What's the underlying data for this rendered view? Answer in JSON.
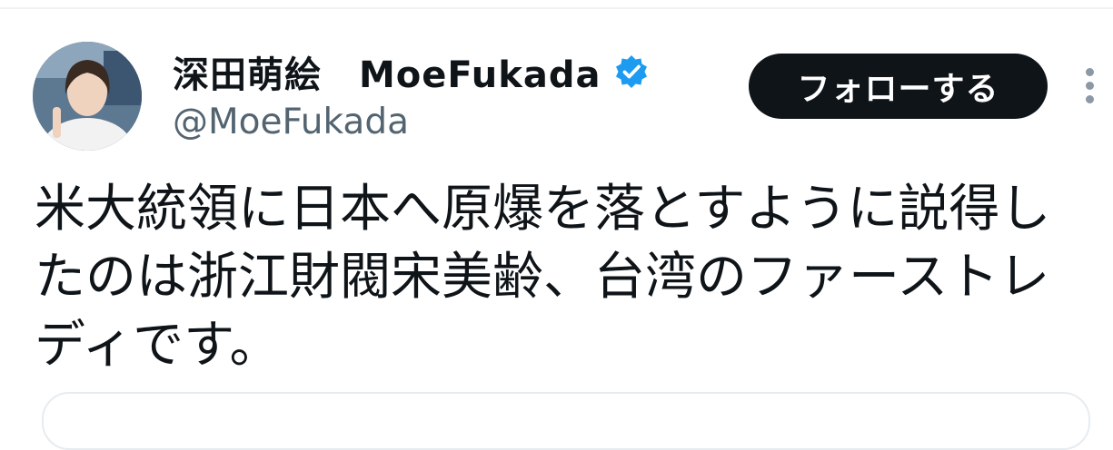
{
  "tweet": {
    "author": {
      "display_name": "深田萌絵　MoeFukada",
      "handle": "@MoeFukada",
      "verified_icon": "verified-badge-icon"
    },
    "follow_button_label": "フォローする",
    "more_icon": "more-vertical-icon",
    "text": "米大統領に日本へ原爆を落とすように説得したのは浙江財閥宋美齢、台湾のファーストレディです。"
  },
  "colors": {
    "primary_text": "#0f1419",
    "secondary_text": "#536471",
    "verified_blue": "#1d9bf0",
    "button_bg": "#0f1419",
    "button_text": "#ffffff"
  }
}
